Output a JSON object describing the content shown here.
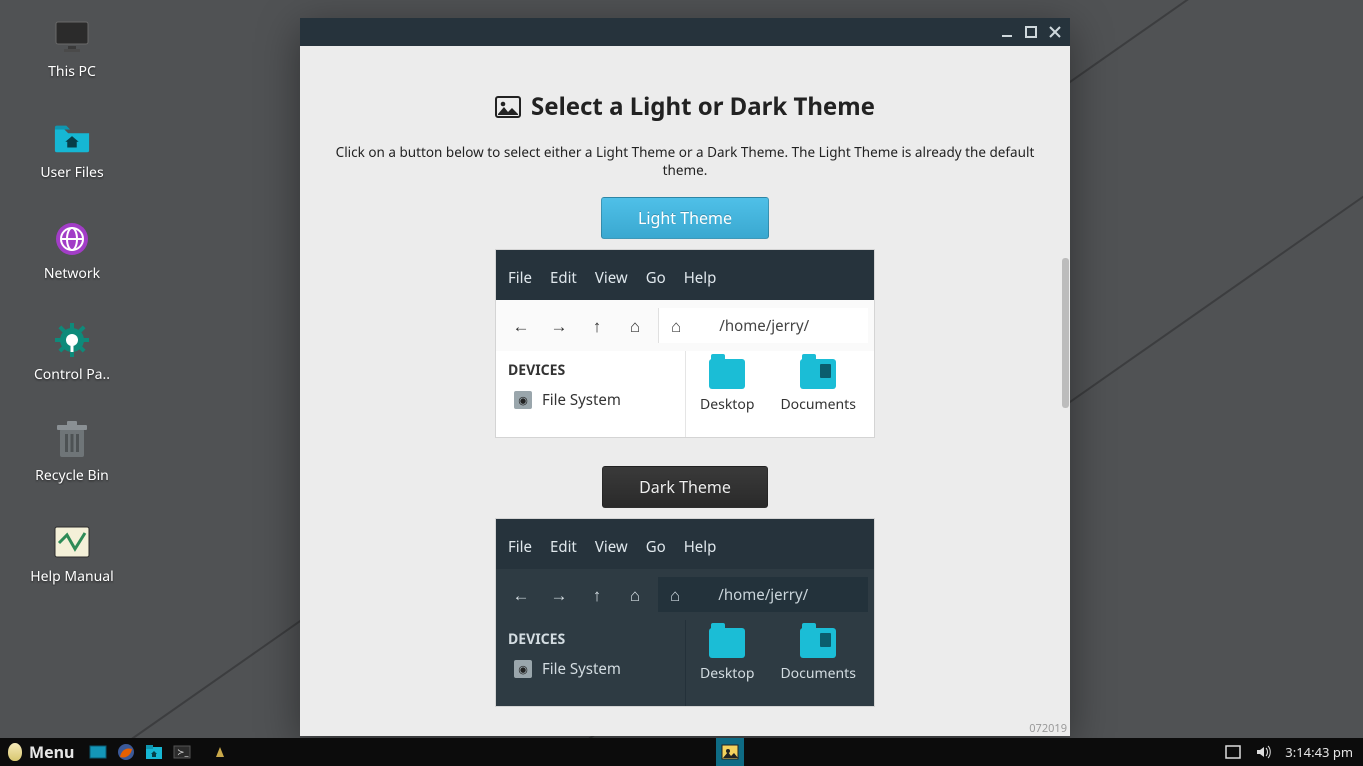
{
  "desktop": [
    {
      "label": "This PC"
    },
    {
      "label": "User Files"
    },
    {
      "label": "Network"
    },
    {
      "label": "Control Pa.."
    },
    {
      "label": "Recycle Bin"
    },
    {
      "label": "Help Manual"
    }
  ],
  "window": {
    "heading": "Select a Light or Dark Theme",
    "description": "Click on a button below to select either a Light Theme or a Dark Theme. The Light Theme is already the default theme.",
    "light_btn": "Light Theme",
    "dark_btn": "Dark Theme",
    "build": "072019"
  },
  "preview": {
    "menus": [
      "File",
      "Edit",
      "View",
      "Go",
      "Help"
    ],
    "path": "/home/jerry/",
    "devices_label": "DEVICES",
    "fs_label": "File System",
    "folders": [
      "Desktop",
      "Documents"
    ]
  },
  "taskbar": {
    "menu": "Menu",
    "time": "3:14:43 pm"
  }
}
